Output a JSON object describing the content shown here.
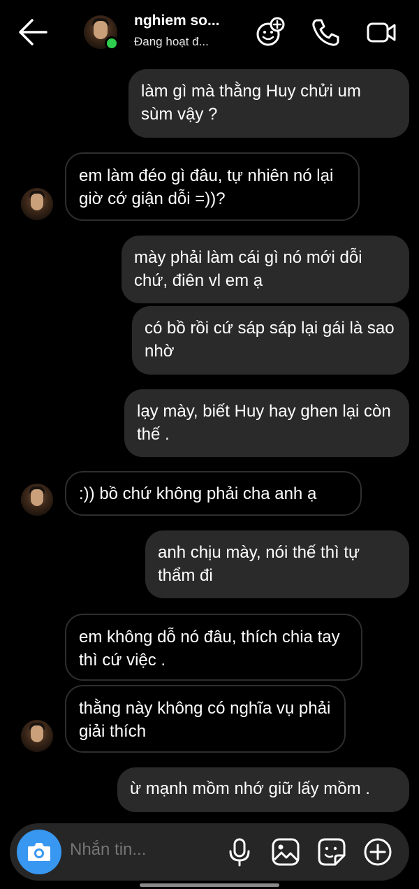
{
  "header": {
    "contact_name": "nghiem so...",
    "status": "Đang hoạt đ..."
  },
  "messages": [
    {
      "from": "me",
      "text": "làm gì mà thằng Huy chửi um sùm vậy ?"
    },
    {
      "from": "them",
      "text": "em làm đéo gì đâu, tự nhiên nó lại giờ cớ giận dỗi =))?"
    },
    {
      "from": "me",
      "text": "mày phải làm cái gì nó mới dỗi chứ, điên vl em ạ"
    },
    {
      "from": "me",
      "text": "có bồ rồi cứ sáp sáp lại gái là sao nhờ"
    },
    {
      "from": "me",
      "text": "lạy mày, biết Huy hay ghen lại còn thế ."
    },
    {
      "from": "them",
      "text": ":)) bồ chứ không phải cha anh ạ"
    },
    {
      "from": "me",
      "text": "anh chịu mày, nói thế thì tự thẩm đi"
    },
    {
      "from": "them",
      "text": "em không dỗ nó đâu, thích chia tay thì cứ việc ."
    },
    {
      "from": "them",
      "text": "thằng này không có nghĩa vụ phải giải thích"
    },
    {
      "from": "me",
      "text": "ừ mạnh mồm nhớ giữ lấy mồm ."
    }
  ],
  "composer": {
    "placeholder": "Nhắn tin..."
  },
  "colors": {
    "background": "#000000",
    "my_bubble": "#2a2a2a",
    "their_bubble_border": "#2e2e2e",
    "camera_button": "#3897f0",
    "online_dot": "#2fce4e"
  },
  "icons": [
    "back-arrow-icon",
    "effects-icon",
    "phone-icon",
    "video-icon",
    "camera-icon",
    "microphone-icon",
    "gallery-icon",
    "sticker-icon",
    "plus-icon"
  ]
}
